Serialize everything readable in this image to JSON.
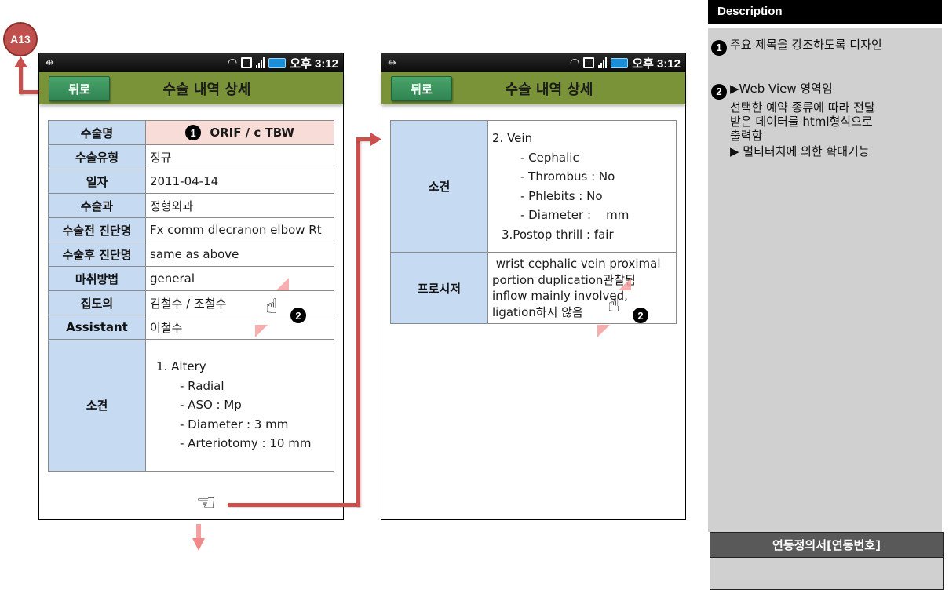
{
  "screen_id": "A13",
  "status_bar": {
    "clock": "오후 3:12"
  },
  "header": {
    "back_label": "뒤로",
    "title": "수술 내역 상세"
  },
  "annotations": {
    "badge_1": "1",
    "badge_2": "2"
  },
  "left_screen": {
    "rows": [
      {
        "label": "수술명",
        "value": "ORIF / c TBW"
      },
      {
        "label": "수술유형",
        "value": "정규"
      },
      {
        "label": "일자",
        "value": "2011-04-14"
      },
      {
        "label": "수술과",
        "value": "정형외과"
      },
      {
        "label": "수술전 진단명",
        "value": "Fx comm dlecranon elbow Rt"
      },
      {
        "label": "수술후 진단명",
        "value": "same as above"
      },
      {
        "label": "마취방법",
        "value": "general"
      },
      {
        "label": "집도의",
        "value": "김철수 / 조철수"
      },
      {
        "label": "Assistant",
        "value": "이철수"
      }
    ],
    "findings": {
      "label": "소견",
      "heading": "1. Altery",
      "items": [
        "- Radial",
        "- ASO : Mp",
        "- Diameter : 3 mm",
        "- Arteriotomy : 10 mm"
      ]
    }
  },
  "right_screen": {
    "findings": {
      "label": "소견",
      "heading": "2. Vein",
      "items": [
        "- Cephalic",
        "- Thrombus : No",
        "- Phlebits : No",
        "- Diameter :    mm"
      ],
      "footer": "3.Postop thrill : fair"
    },
    "procedure": {
      "label": "프로시저",
      "lines": [
        " wrist cephalic vein proximal",
        "portion duplication관찰됨",
        "inflow mainly involved,",
        "ligation하지 않음"
      ]
    }
  },
  "description": {
    "title": "Description",
    "item1": "주요 제목을 강조하도록 디자인",
    "item2_lines": [
      "▶Web View 영역임",
      "선택한 예약 종류에 따라 전달",
      "받은 데이터를 html형식으로",
      "출력함",
      "▶ 멀티터치에 의한 확대기능"
    ],
    "link_title": "연동정의서[연동번호]"
  },
  "colors": {
    "titlebar": "#7a9338",
    "back_button": "#3a9160",
    "label_cell": "#c6daf1",
    "highlight_cell": "#f8dcd7",
    "annotation_red": "#c9504d",
    "panel_gray": "#d0d0d0"
  }
}
